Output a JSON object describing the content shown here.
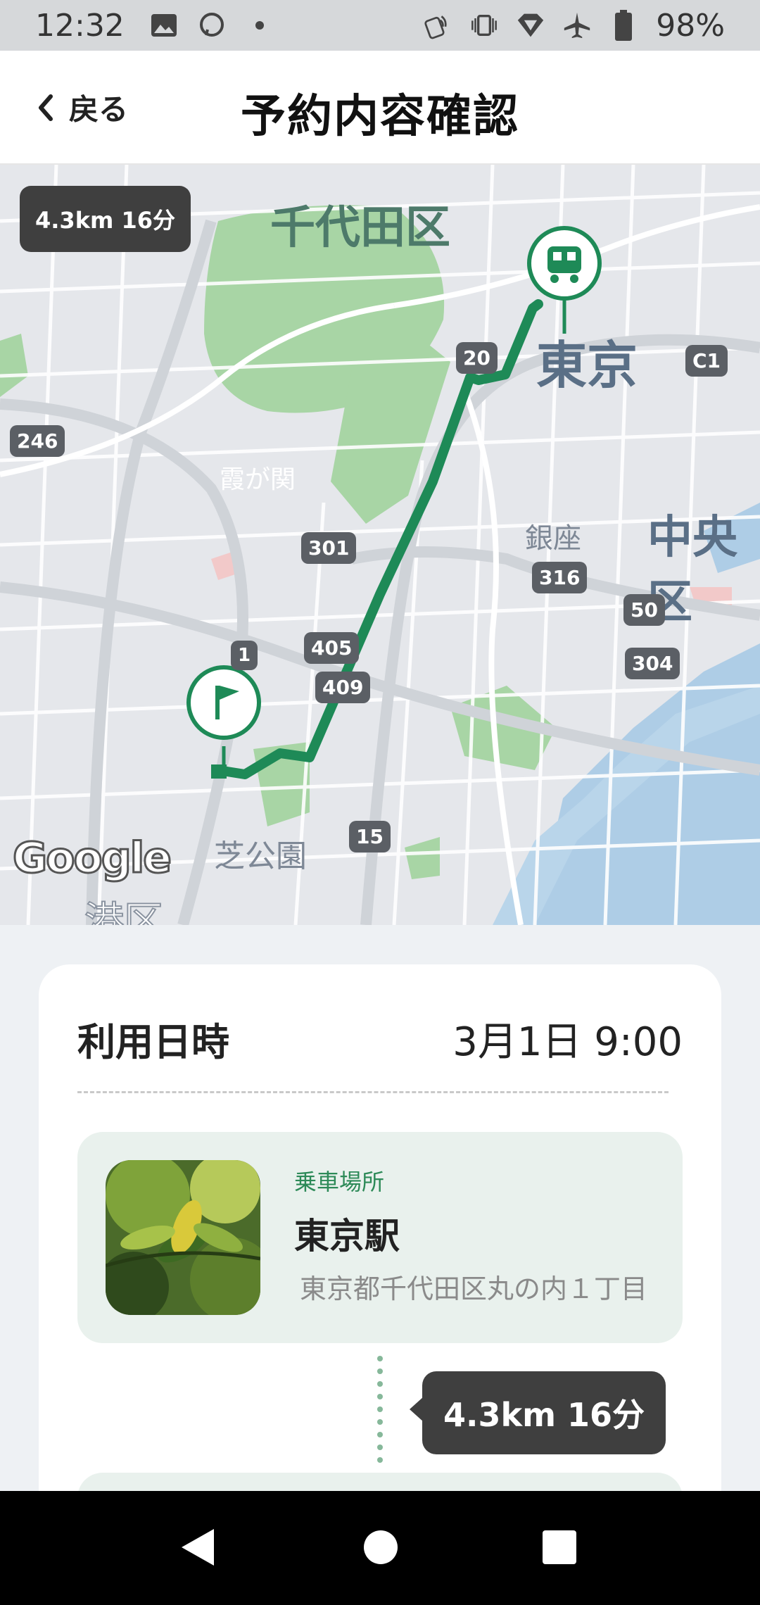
{
  "status_bar": {
    "time": "12:32",
    "battery": "98%",
    "icons_left": [
      "image-icon",
      "messenger-icon",
      "dot-icon"
    ],
    "icons_right": [
      "nfc-icon",
      "vibrate-icon",
      "signal-icon",
      "airplane-icon",
      "battery-icon"
    ]
  },
  "header": {
    "back_label": "戻る",
    "title": "予約内容確認"
  },
  "map": {
    "distance_badge": "4.3km 16分",
    "labels": {
      "chiyoda": "千代田区",
      "tokyo": "東京",
      "chuo": "中央区",
      "ginza": "銀座",
      "shiba_park": "芝公園",
      "kasumigaseki": "霞が関",
      "minato": "港区"
    },
    "road_numbers": [
      "20",
      "C1",
      "246",
      "301",
      "316",
      "50",
      "405",
      "409",
      "304",
      "1",
      "15"
    ],
    "google": "Google",
    "route_color": "#1e8a57"
  },
  "booking": {
    "datetime_label": "利用日時",
    "datetime_value": "3月1日 9:00",
    "pickup": {
      "type": "乗車場所",
      "name": "東京駅",
      "address": "東京都千代田区丸の内１丁目"
    },
    "segment": "4.3km 16分"
  },
  "navbar": {
    "buttons": [
      "back-nav",
      "home-nav",
      "recents-nav"
    ]
  }
}
